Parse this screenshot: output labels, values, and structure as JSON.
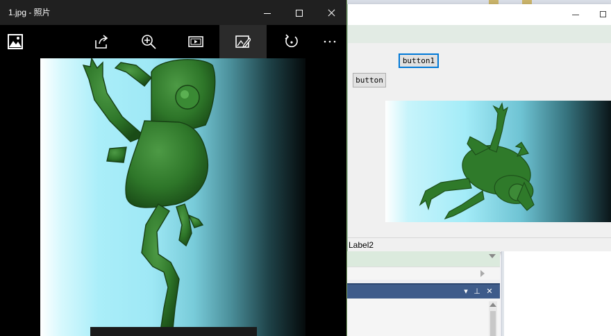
{
  "photos": {
    "title": "1.jpg - 照片",
    "toolbar": {
      "gallery_icon": "image-gallery-icon",
      "share_icon": "share-icon",
      "zoom_icon": "zoom-in-icon",
      "slideshow_icon": "slideshow-icon",
      "edit_icon": "edit-image-icon",
      "rotate_icon": "rotate-icon",
      "more_icon": "more-ellipsis-icon"
    },
    "image_subject": "frog-image"
  },
  "form": {
    "button1_label": "button1",
    "button_label": "button",
    "label2_text": "Label2"
  },
  "colors": {
    "photos_titlebar": "#202020",
    "photos_toolbar": "#000000",
    "selected_tool": "#2b2b2b",
    "focus_border": "#0078d7",
    "tool_window_header": "#3e5b8a",
    "frog_green": "#2f7a2a"
  }
}
